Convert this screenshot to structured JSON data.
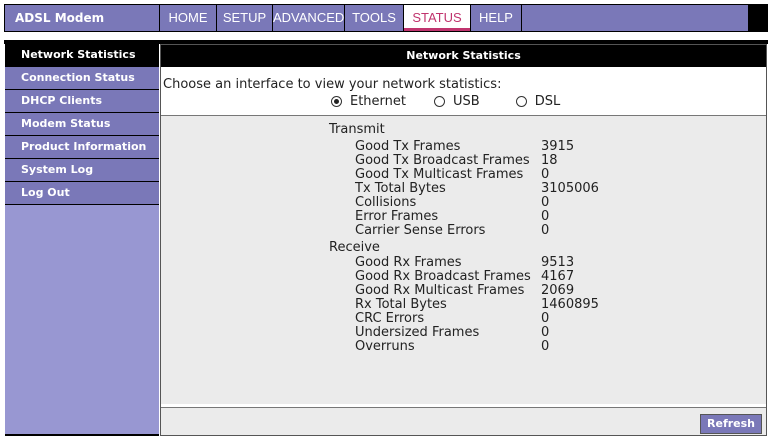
{
  "brand": "ADSL Modem",
  "tabs": [
    {
      "label": "HOME",
      "active": false
    },
    {
      "label": "SETUP",
      "active": false
    },
    {
      "label": "ADVANCED",
      "active": false
    },
    {
      "label": "TOOLS",
      "active": false
    },
    {
      "label": "STATUS",
      "active": true
    },
    {
      "label": "HELP",
      "active": false
    }
  ],
  "sidebar": {
    "items": [
      {
        "label": "Network Statistics",
        "active": true
      },
      {
        "label": "Connection Status",
        "active": false
      },
      {
        "label": "DHCP Clients",
        "active": false
      },
      {
        "label": "Modem Status",
        "active": false
      },
      {
        "label": "Product Information",
        "active": false
      },
      {
        "label": "System Log",
        "active": false
      },
      {
        "label": "Log Out",
        "active": false
      }
    ]
  },
  "main": {
    "title": "Network Statistics",
    "choose_text": "Choose an interface to view your network statistics:",
    "interfaces": [
      {
        "label": "Ethernet",
        "selected": true
      },
      {
        "label": "USB",
        "selected": false
      },
      {
        "label": "DSL",
        "selected": false
      }
    ],
    "transmit": {
      "heading": "Transmit",
      "rows": [
        {
          "label": "Good Tx Frames",
          "value": "3915"
        },
        {
          "label": "Good Tx Broadcast Frames",
          "value": "18"
        },
        {
          "label": "Good Tx Multicast Frames",
          "value": "0"
        },
        {
          "label": "Tx Total Bytes",
          "value": "3105006"
        },
        {
          "label": "Collisions",
          "value": "0"
        },
        {
          "label": "Error Frames",
          "value": "0"
        },
        {
          "label": "Carrier Sense Errors",
          "value": "0"
        }
      ]
    },
    "receive": {
      "heading": "Receive",
      "rows": [
        {
          "label": "Good Rx Frames",
          "value": "9513"
        },
        {
          "label": "Good Rx Broadcast Frames",
          "value": "4167"
        },
        {
          "label": "Good Rx Multicast Frames",
          "value": "2069"
        },
        {
          "label": "Rx Total Bytes",
          "value": "1460895"
        },
        {
          "label": "CRC Errors",
          "value": "0"
        },
        {
          "label": "Undersized Frames",
          "value": "0"
        },
        {
          "label": "Overruns",
          "value": "0"
        }
      ]
    },
    "refresh_label": "Refresh"
  },
  "colors": {
    "nav": "#7a78b8",
    "sidebar_fill": "#9897d2",
    "active_tab_text": "#c0346e"
  }
}
